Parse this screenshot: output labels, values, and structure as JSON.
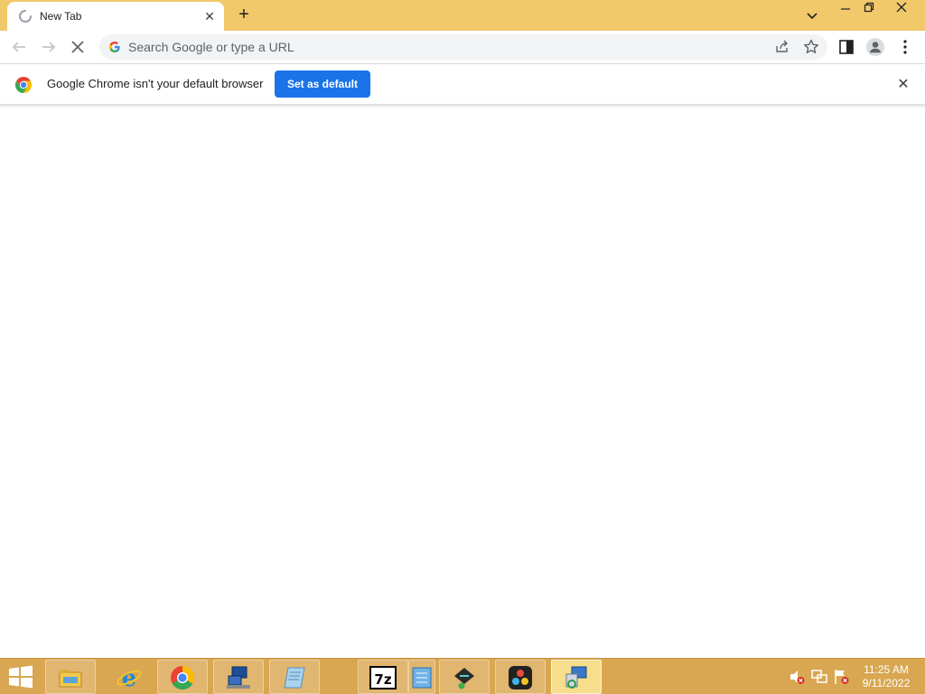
{
  "browser": {
    "tab": {
      "title": "New Tab"
    },
    "omnibox": {
      "placeholder": "Search Google or type a URL"
    },
    "infobar": {
      "message": "Google Chrome isn't your default browser",
      "button_label": "Set as default"
    }
  },
  "colors": {
    "titlebar": "#f1c96b",
    "accent": "#1a73e8",
    "taskbar": "#d9a751"
  },
  "taskbar": {
    "apps": [
      {
        "name": "file-explorer-icon"
      },
      {
        "name": "internet-explorer-icon"
      },
      {
        "name": "chrome-icon"
      },
      {
        "name": "network-computer-icon"
      },
      {
        "name": "notepad-icon"
      },
      {
        "name": "7zip-icon"
      },
      {
        "name": "installer-icon"
      },
      {
        "name": "davinci-resolve-icon"
      },
      {
        "name": "remote-desktop-icon"
      }
    ],
    "clock": {
      "time": "11:25 AM",
      "date": "9/11/2022"
    }
  }
}
